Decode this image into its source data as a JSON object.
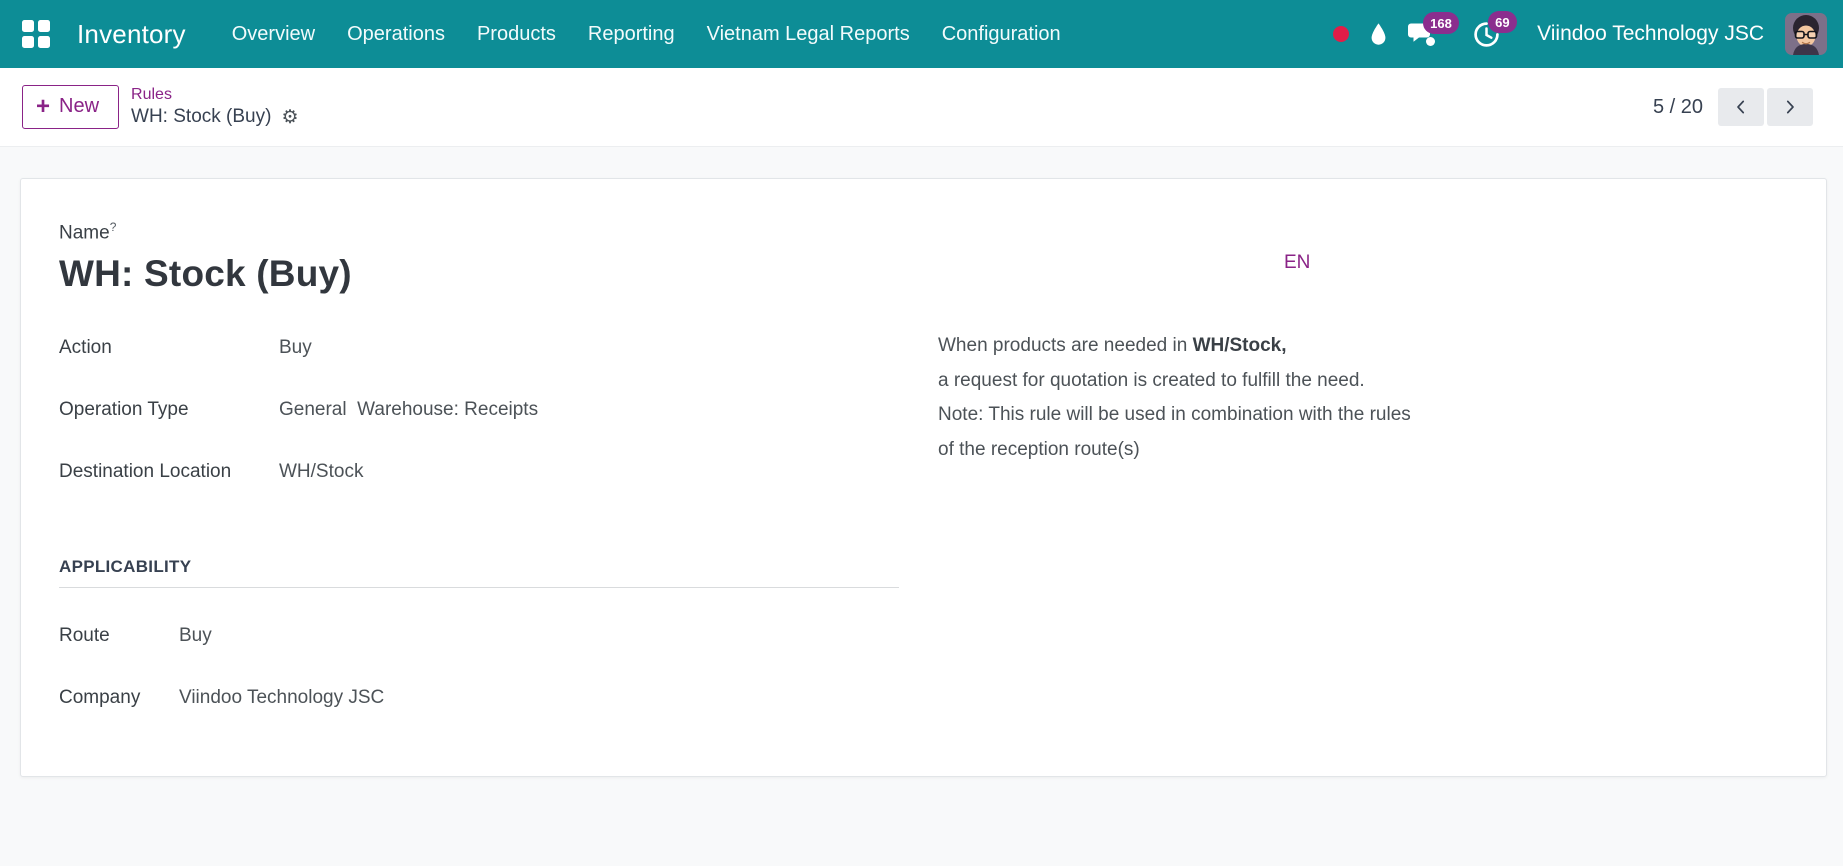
{
  "navbar": {
    "app_name": "Inventory",
    "menu": [
      "Overview",
      "Operations",
      "Products",
      "Reporting",
      "Vietnam Legal Reports",
      "Configuration"
    ],
    "message_badge": "168",
    "activity_badge": "69",
    "company": "Viindoo Technology JSC"
  },
  "control_panel": {
    "new_label": "New",
    "breadcrumb": {
      "parent": "Rules",
      "current": "WH: Stock (Buy)"
    },
    "pager_value": "5 / 20"
  },
  "form": {
    "name_label": "Name",
    "name_help": "?",
    "title": "WH: Stock (Buy)",
    "fields": [
      {
        "label": "Action",
        "value": "Buy"
      },
      {
        "label": "Operation Type",
        "value": "General  Warehouse: Receipts"
      },
      {
        "label": "Destination Location",
        "value": "WH/Stock"
      }
    ],
    "section_title": "APPLICABILITY",
    "applicability": [
      {
        "label": "Route",
        "value": "Buy"
      },
      {
        "label": "Company",
        "value": "Viindoo Technology JSC"
      }
    ],
    "language_badge": "EN",
    "description": {
      "line1_prefix": "When products are needed in ",
      "line1_bold": "WH/Stock",
      "line1_suffix": ",",
      "line2": "a request for quotation is created to fulfill the need.",
      "line3": "Note: This rule will be used in combination with the rules",
      "line4": "of the reception route(s)"
    }
  },
  "icons": {
    "gear": "⚙",
    "plus": "+"
  },
  "colors": {
    "navbar_teal": "#0d8d96",
    "accent_purple": "#8a2387",
    "badge_purple": "#8b2e8e",
    "record_dot_red": "#e11d48"
  }
}
